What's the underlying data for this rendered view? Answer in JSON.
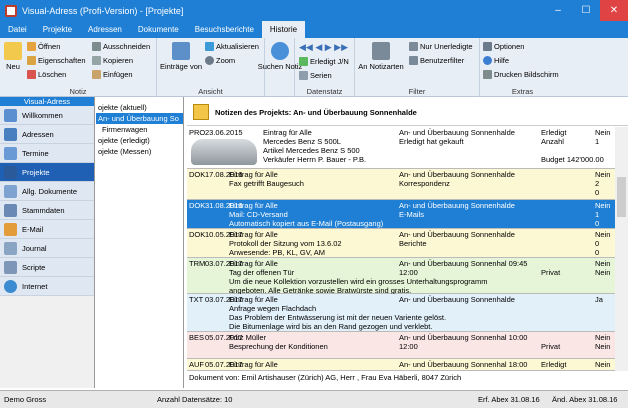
{
  "window": {
    "title": "Visual-Adress (Profi-Version) - [Projekte]",
    "min": "–",
    "max": "☐",
    "close": "✕"
  },
  "menu": [
    "Datei",
    "Projekte",
    "Adressen",
    "Dokumente",
    "Besuchsberichte",
    "Historie"
  ],
  "ribbon": {
    "neu": "Neu",
    "oeffnen": "Öffnen",
    "eigenschaften": "Eigenschaften",
    "loeschen": "Löschen",
    "ausschneiden": "Ausschneiden",
    "kopieren": "Kopieren",
    "einfuegen": "Einfügen",
    "eintraege_von": "Einträge von",
    "aktualisieren": "Aktualisieren",
    "zoom": "Zoom",
    "suchen_notiz": "Suchen Notiz",
    "erledigt": "Erledigt J/N",
    "serien": "Serien",
    "an_notizen": "An Notizarten",
    "nur_unerledigte": "Nur Unerledigte",
    "benutzerfilter": "Benutzerfilter",
    "optionen": "Optionen",
    "hilfe": "Hilfe",
    "drucken": "Drucken Bildschirm",
    "groups": {
      "notiz": "Notiz",
      "ansicht": "Ansicht",
      "datenstatz": "Datenstatz",
      "filter": "Filter",
      "extras": "Extras"
    }
  },
  "sidebar": {
    "header": "Visual-Adress",
    "items": [
      "Willkommen",
      "Adressen",
      "Termine",
      "Projekte",
      "Allg. Dokumente",
      "Stammdaten",
      "E-Mail",
      "Journal",
      "Scripte",
      "Internet"
    ]
  },
  "tree": [
    "ojekte (aktuell)",
    "An- und Überbauung So",
    "Firmenwagen",
    "ojekte (erledigt)",
    "ojekte (Messen)"
  ],
  "notes": {
    "header": "Notizen des Projekts: An- und Überbauung Sonnenhalde"
  },
  "rows": [
    {
      "a": "PRO",
      "b": "23.06.2015",
      "c": [
        "Eintrag für Alle",
        "Mercedes Benz S 500L",
        "Artikel       Mercedes Benz S 500",
        "Verkäufer     Herrn P. Bauer - P.B."
      ],
      "d": [
        "An- und Überbauung Sonnenhalde",
        "Erledigt hat gekauft"
      ],
      "e": [
        "Erledigt",
        "Anzahl",
        "",
        "Budget 142'000.00"
      ],
      "f": [
        "Nein",
        "1",
        "",
        ""
      ]
    },
    {
      "a": "DOK",
      "b": "17.08.2016",
      "c": [
        "Eintrag für Alle",
        "Fax getrifft Baugesuch"
      ],
      "d": [
        "An- und Überbauung Sonnenhalde",
        "Korrespondenz"
      ],
      "e": [
        "",
        ""
      ],
      "f": [
        "Nein",
        "2",
        "0"
      ]
    },
    {
      "a": "DOK",
      "b": "31.08.2016",
      "c": [
        "Eintrag für Alle",
        "Mail: CD-Versand",
        "Automatisch kopiert aus E-Mail (Postausgang)"
      ],
      "d": [
        "An- und Überbauung Sonnenhalde",
        "E-Mails"
      ],
      "e": [
        "",
        ""
      ],
      "f": [
        "Nein",
        "1",
        "0"
      ]
    },
    {
      "a": "DOK",
      "b": "10.05.2017",
      "c": [
        "Eintrag für Alle",
        "Protokoll der Sitzung vom 13.6.02",
        "Anwesende: PB, KL, GV, AM"
      ],
      "d": [
        "An- und Überbauung Sonnenhalde",
        "Berichte"
      ],
      "e": [
        "",
        ""
      ],
      "f": [
        "Nein",
        "0",
        "0"
      ]
    },
    {
      "a": "TRM",
      "b": "03.07.2017",
      "c": [
        "Eintrag für Alle",
        "Tag der offenen Tür",
        "Um die neue Kollektion vorzustellen wird ein grosses Unterhaltungsprogramm",
        "angeboten. Alle Getränke sowie Bratwürste sind gratis."
      ],
      "d": [
        "An- und Überbauung Sonnenhal  09:45",
        "                                   12:00"
      ],
      "e": [
        "",
        "Privat"
      ],
      "f": [
        "Nein",
        "Nein"
      ]
    },
    {
      "a": "TXT",
      "b": "03.07.2017",
      "c": [
        "Eintrag für Alle",
        "Anfrage wegen Flachdach",
        "Das Problem der Entwässerung ist mit der neuen Variente gelöst.",
        "Die Bitumenlage wird bis an den Rand gezogen und verklebt."
      ],
      "d": [
        "An- und Überbauung Sonnenhalde"
      ],
      "e": [
        ""
      ],
      "f": [
        "Ja"
      ]
    },
    {
      "a": "BES",
      "b": "05.07.2017",
      "c": [
        "Fritz Müller",
        "Besprechung der Konditionen"
      ],
      "d": [
        "An- und Überbauung Sonnenhal  10:00",
        "                                   12:00"
      ],
      "e": [
        "",
        "Privat"
      ],
      "f": [
        "Nein",
        "Nein"
      ]
    },
    {
      "a": "AUF",
      "b": "05.07.2017",
      "c": [
        "Eintrag für Alle"
      ],
      "d": [
        "An- und Überbauung Sonnenhal  18:00"
      ],
      "e": [
        "Erledigt"
      ],
      "f": [
        "Nein"
      ]
    }
  ],
  "doc_footer": "Dokument von: Emil Artishauser (Zürich) AG, Herr , Frau Eva Häberli, 8047 Zürich",
  "status": {
    "user": "Demo Gross",
    "count": "Anzahl Datensätze: 10",
    "erf": "Erf.   Abex 31.08.16",
    "aend": "Änd. Abex 31.08.16"
  },
  "colors": {
    "accent": "#1f7fd4",
    "selected": "#1f7fd4",
    "yellow_row": "#fdf8d4",
    "green_row": "#e6f5d8",
    "blue_row": "#e2f0fa",
    "pink_row": "#fbe6e6"
  }
}
